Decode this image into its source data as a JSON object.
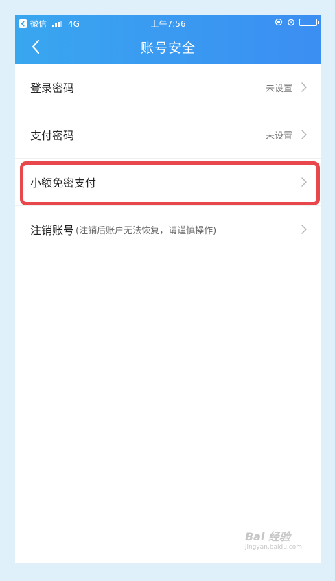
{
  "status_bar": {
    "carrier_app": "微信",
    "network": "4G",
    "time": "上午7:56"
  },
  "navbar": {
    "title": "账号安全"
  },
  "rows": [
    {
      "label": "登录密码",
      "hint": "",
      "value": "未设置"
    },
    {
      "label": "支付密码",
      "hint": "",
      "value": "未设置"
    },
    {
      "label": "小额免密支付",
      "hint": "",
      "value": ""
    },
    {
      "label": "注销账号",
      "hint": "(注销后账户无法恢复，请谨慎操作)",
      "value": ""
    }
  ],
  "colors": {
    "header_start": "#39a6f0",
    "header_end": "#3b8ef2",
    "highlight": "#e8474b",
    "background": "#e0f0fb"
  },
  "watermark": {
    "brand": "Bai 经验",
    "url": "jingyan.baidu.com"
  }
}
